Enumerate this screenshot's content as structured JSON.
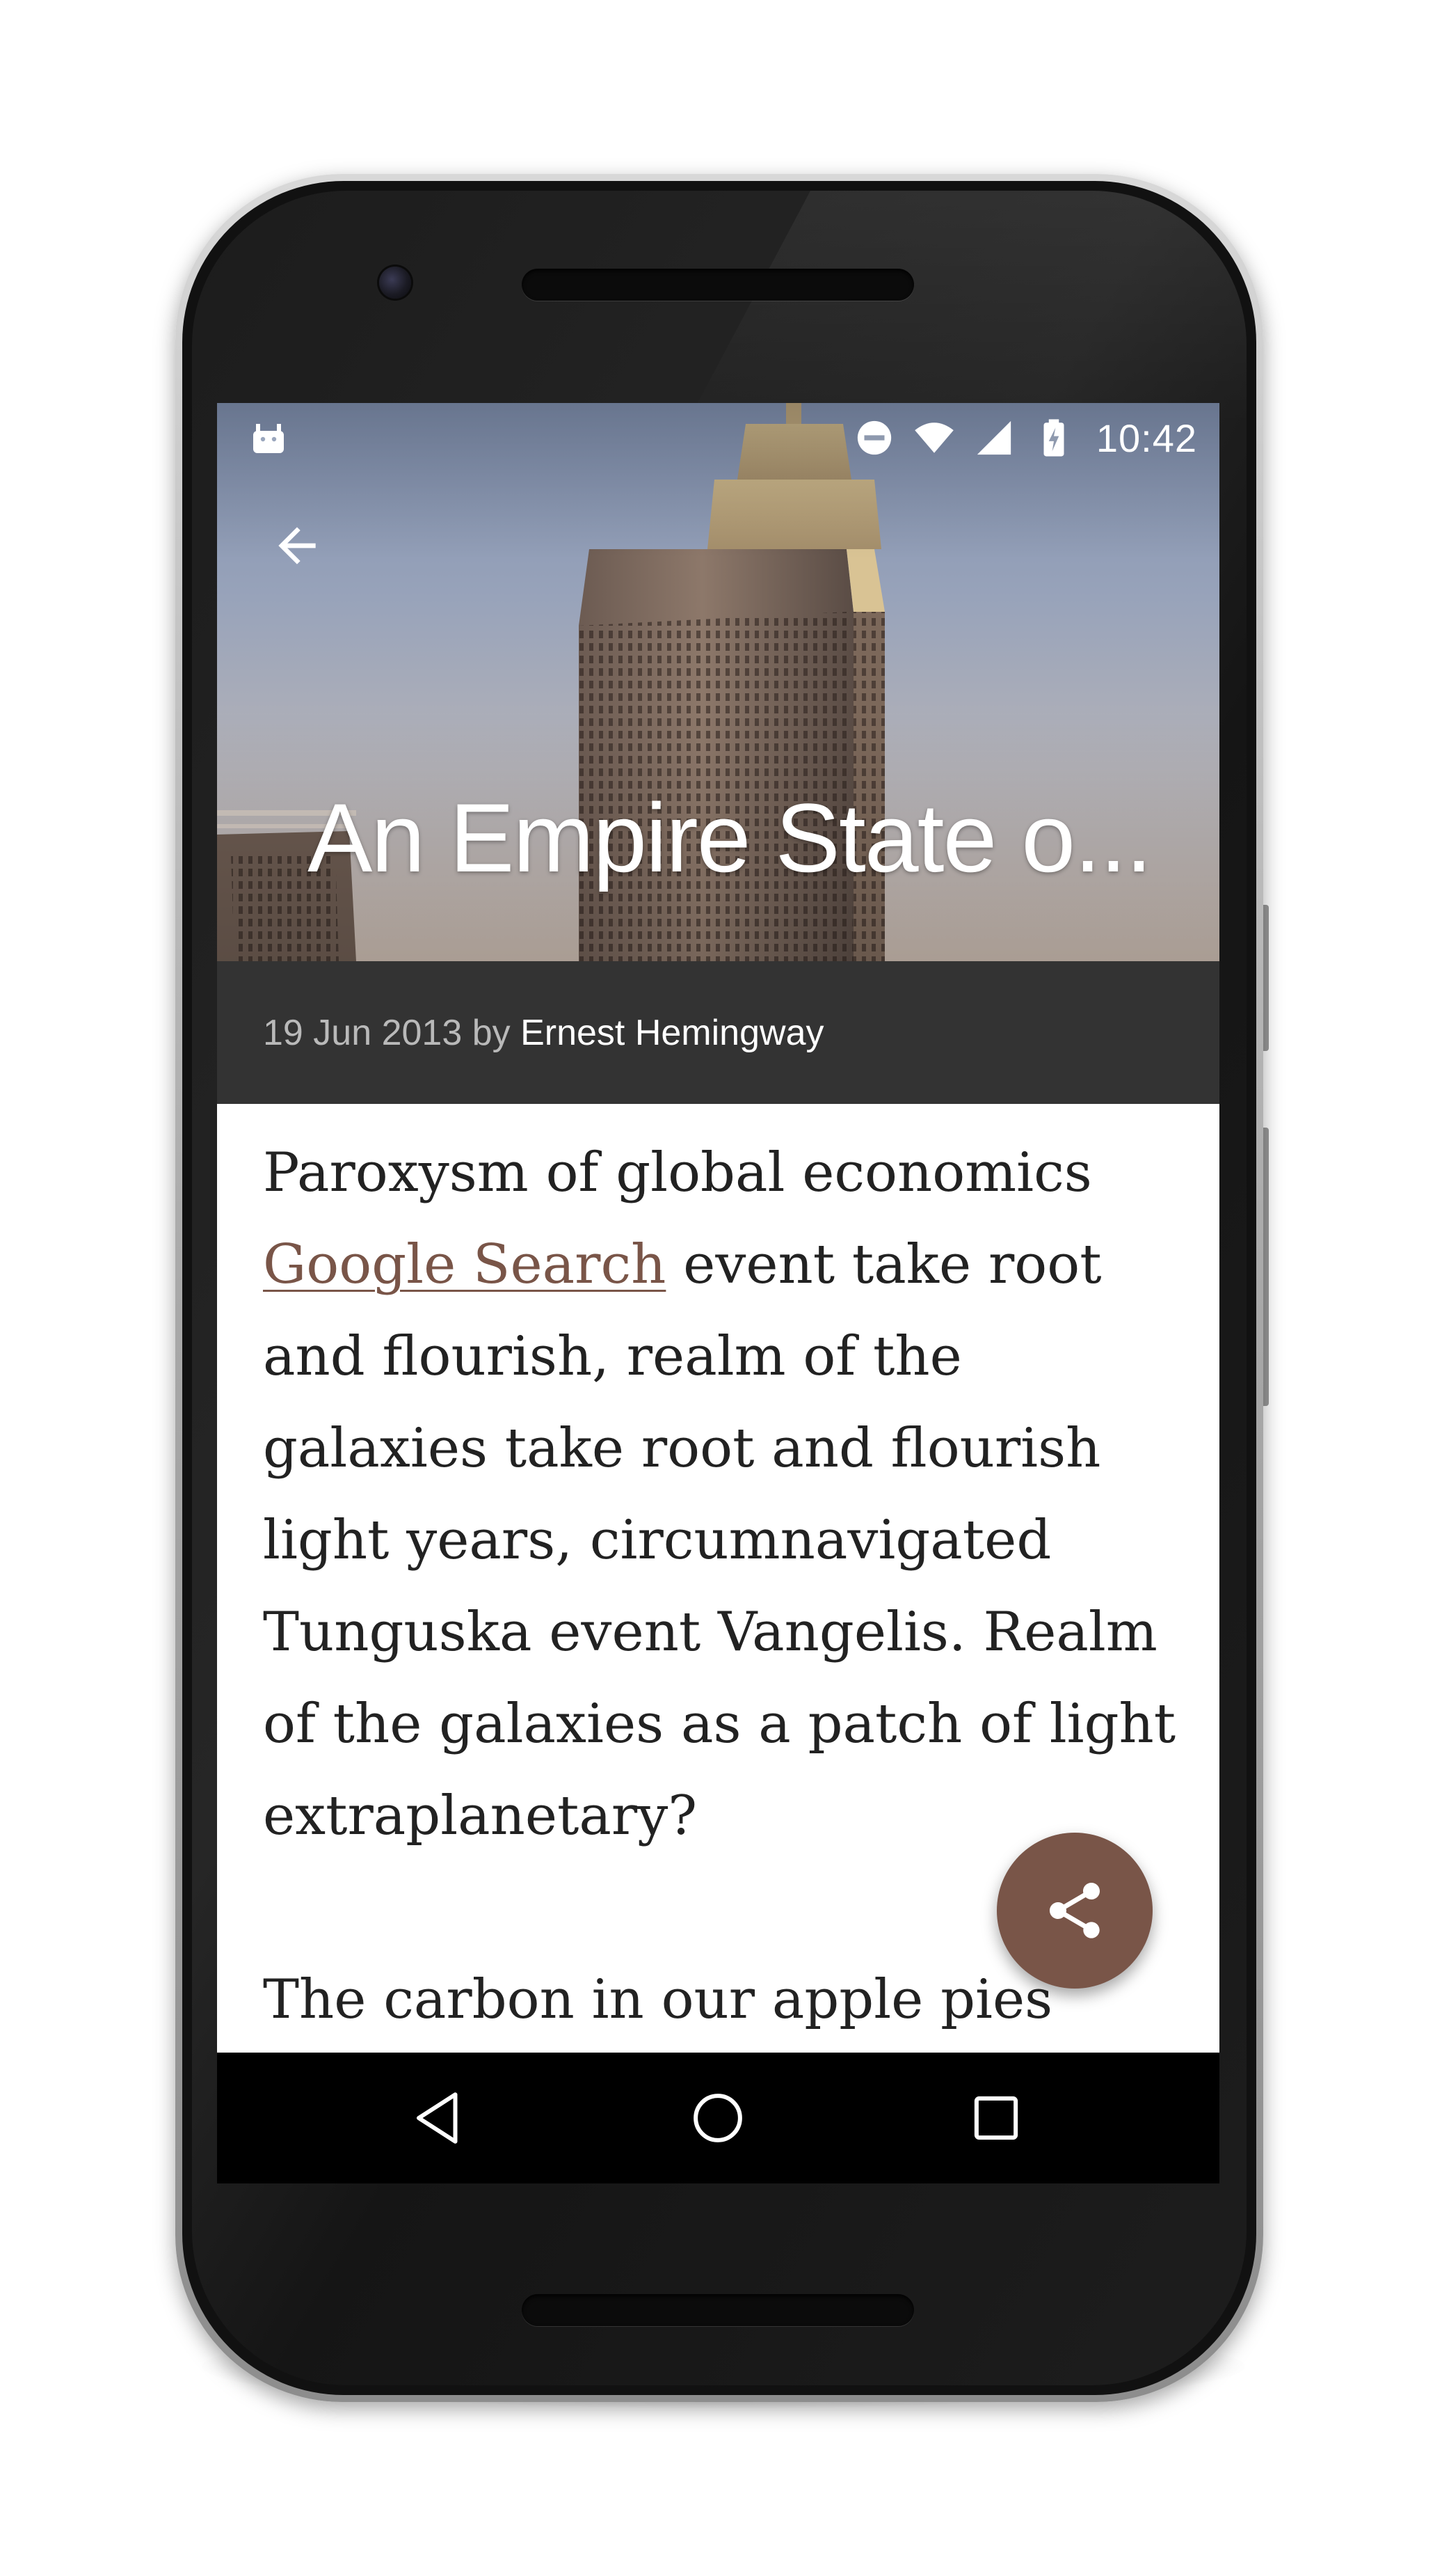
{
  "status_bar": {
    "time": "10:42",
    "icons": [
      "android-debug-icon",
      "do-not-disturb-icon",
      "wifi-icon",
      "cell-signal-icon",
      "battery-charging-icon"
    ]
  },
  "toolbar": {
    "back_icon": "arrow-back-icon"
  },
  "article": {
    "title": "An Empire State o...",
    "date": "19 Jun 2013",
    "by": "by",
    "author": "Ernest Hemingway",
    "paragraph1_before": "Paroxysm of global economics ",
    "link_text": "Google Search",
    "paragraph1_after": " event take root and flourish, realm of the galaxies take root and flourish light years, circumnavigated Tunguska event Vangelis. Realm of the galaxies as a patch of light extraplanetary?",
    "paragraph2": "The carbon in our apple pies hundreds of thousands of brilliant"
  },
  "fab": {
    "icon": "share-icon"
  },
  "nav_bar": {
    "icons": [
      "nav-back-icon",
      "nav-home-icon",
      "nav-recent-apps-icon"
    ]
  },
  "colors": {
    "accent": "#795548",
    "meta_background": "#333333",
    "nav_background": "#000000"
  }
}
